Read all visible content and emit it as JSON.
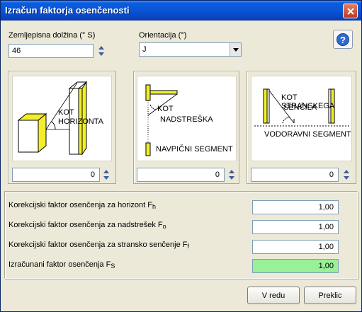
{
  "window": {
    "title": "Izračun faktorja osenčenosti"
  },
  "longitude": {
    "label": "Zemljepisna dolžina (° S)",
    "value": "46"
  },
  "orientation": {
    "label": "Orientacija (°)",
    "value": "J"
  },
  "panels": [
    {
      "text1": "KOT",
      "text2": "HORIZONTA",
      "value": "0"
    },
    {
      "text1": "KOT",
      "text2": "NADSTREŠKA",
      "text3": "NAVPIČNI  SEGMENT",
      "value": "0"
    },
    {
      "text1": "KOT STRANSKEGA",
      "text2": "SENČILA",
      "text3": "VODORAVNI SEGMENT",
      "value": "0"
    }
  ],
  "factors": [
    {
      "label": "Korekcijski faktor osenčenja za horizont F",
      "sub": "h",
      "value": "1,00"
    },
    {
      "label": "Korekcijski faktor osenčenja za nadstrešek F",
      "sub": "o",
      "value": "1,00"
    },
    {
      "label": "Korekcijski faktor osenčenja za stransko senčenje F",
      "sub": "f",
      "value": "1,00"
    },
    {
      "label": "Izračunani faktor osenčenja F",
      "sub": "S",
      "value": "1,00"
    }
  ],
  "buttons": {
    "ok": "V redu",
    "cancel": "Preklic"
  },
  "colors": {
    "result_bg": "#98f098",
    "titlebar": "#0a55d6",
    "accent_yellow": "#f2ef2a"
  }
}
